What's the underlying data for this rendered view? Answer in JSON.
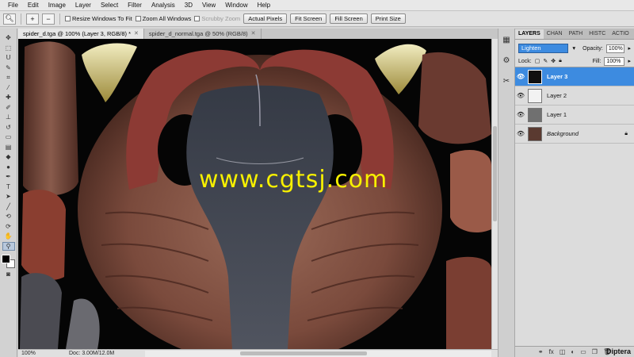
{
  "menu": [
    "File",
    "Edit",
    "Image",
    "Layer",
    "Select",
    "Filter",
    "Analysis",
    "3D",
    "View",
    "Window",
    "Help"
  ],
  "options": {
    "tool_icon": "zoom-icon",
    "resize_windows": "Resize Windows To Fit",
    "zoom_all": "Zoom All Windows",
    "scrubby_zoom": "Scrubby Zoom",
    "actual_pixels": "Actual Pixels",
    "fit_screen": "Fit Screen",
    "fill_screen": "Fill Screen",
    "print_size": "Print Size"
  },
  "documents": [
    {
      "title": "spider_d.tga @ 100% (Layer 3, RGB/8) *",
      "active": true
    },
    {
      "title": "spider_d_normal.tga @ 50% (RGB/8)",
      "active": false
    }
  ],
  "watermark": "www.cgtsj.com",
  "status": {
    "zoom": "100%",
    "doc": "Doc: 3.00M/12.0M"
  },
  "layers_panel": {
    "tabs": [
      "LAYERS",
      "CHAN",
      "PATH",
      "HISTC",
      "ACTIO"
    ],
    "blend_mode": "Lighten",
    "opacity_label": "Opacity:",
    "opacity_value": "100%",
    "lock_label": "Lock:",
    "fill_label": "Fill:",
    "fill_value": "100%",
    "layers": [
      {
        "name": "Layer 3",
        "selected": true
      },
      {
        "name": "Layer 2",
        "selected": false
      },
      {
        "name": "Layer 1",
        "selected": false
      },
      {
        "name": "Background",
        "selected": false,
        "locked": true
      }
    ],
    "footer_icons": [
      "link-icon",
      "fx-icon",
      "mask-icon",
      "adjustment-icon",
      "group-icon",
      "new-layer-icon",
      "trash-icon"
    ]
  },
  "corner_logo": "Diptera",
  "colors": {
    "accent": "#3d8be0",
    "watermark": "#f7f000"
  }
}
